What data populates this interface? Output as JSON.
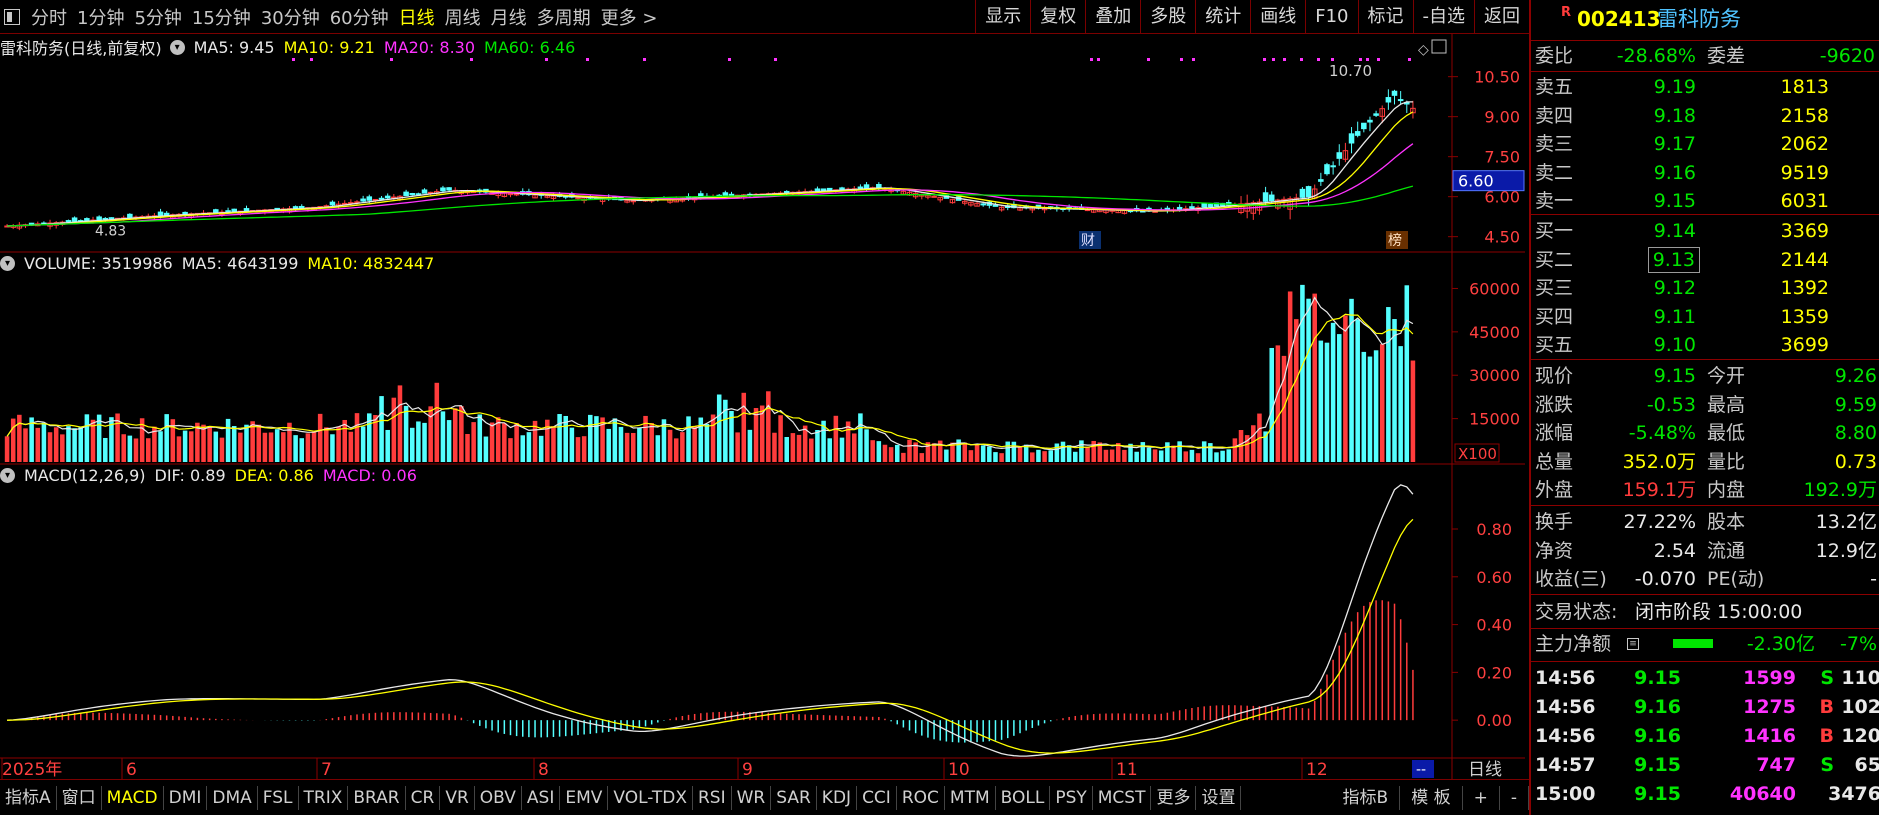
{
  "toolbar": {
    "periods": [
      "分时",
      "1分钟",
      "5分钟",
      "15分钟",
      "30分钟",
      "60分钟",
      "日线",
      "周线",
      "月线",
      "多周期",
      "更多 >"
    ],
    "active_period": "日线",
    "buttons": [
      "显示",
      "复权",
      "叠加",
      "多股",
      "统计",
      "画线",
      "F10",
      "标记",
      "-自选",
      "返回"
    ]
  },
  "header": {
    "price": {
      "name": "雷科防务(日线,前复权)",
      "ma5": "MA5: 9.45",
      "ma10": "MA10: 9.21",
      "ma20": "MA20: 8.30",
      "ma60": "MA60: 6.46"
    },
    "volume": {
      "name": "VOLUME: 3519986",
      "ma5": "MA5: 4643199",
      "ma10": "MA10: 4832447"
    },
    "macd": {
      "name": "MACD(12,26,9)",
      "dif": "DIF: 0.89",
      "dea": "DEA: 0.86",
      "macd": "MACD: 0.06"
    }
  },
  "chart_data": [
    {
      "type": "candlestick",
      "panel": "price",
      "y_ticks": [
        "10.50",
        "9.00",
        "7.50",
        "6.00",
        "4.50"
      ],
      "ylim": [
        4.0,
        11.2
      ],
      "current_price_tag": "6.60",
      "annotations": {
        "high": "10.70",
        "low": "4.83",
        "badge_cai": "财",
        "badge_bang": "榜"
      },
      "series": [
        {
          "name": "MA5",
          "color": "#e8e8e8"
        },
        {
          "name": "MA10",
          "color": "#ffff00"
        },
        {
          "name": "MA20",
          "color": "#ff33ff"
        },
        {
          "name": "MA60",
          "color": "#00e600"
        }
      ]
    },
    {
      "type": "bar",
      "panel": "volume",
      "y_ticks": [
        "60000",
        "45000",
        "30000",
        "15000"
      ],
      "unit": "X100",
      "ylim": [
        0,
        65000
      ],
      "series": [
        {
          "name": "MA5",
          "color": "#e8e8e8"
        },
        {
          "name": "MA10",
          "color": "#ffff00"
        }
      ]
    },
    {
      "type": "bar",
      "panel": "macd",
      "y_ticks": [
        "0.80",
        "0.60",
        "0.40",
        "0.20",
        "0.00"
      ],
      "ylim": [
        -0.15,
        0.98
      ],
      "series": [
        {
          "name": "DIF",
          "color": "#e8e8e8"
        },
        {
          "name": "DEA",
          "color": "#ffff00"
        },
        {
          "name": "MACD",
          "color": "#ff33ff"
        }
      ]
    }
  ],
  "x_axis": {
    "labels": [
      "2025年",
      "6",
      "7",
      "8",
      "9",
      "10",
      "11",
      "12"
    ],
    "right_tag": "--",
    "period_label": "日线"
  },
  "bottom": {
    "tabs": [
      "指标A",
      "窗口",
      "MACD",
      "DMI",
      "DMA",
      "FSL",
      "TRIX",
      "BRAR",
      "CR",
      "VR",
      "OBV",
      "ASI",
      "EMV",
      "VOL-TDX",
      "RSI",
      "WR",
      "SAR",
      "KDJ",
      "CCI",
      "ROC",
      "MTM",
      "BOLL",
      "PSY",
      "MCST",
      "更多",
      "设置"
    ],
    "active": "MACD",
    "right": [
      "指标B",
      "模 板",
      "+",
      "-"
    ]
  },
  "panel": {
    "badge": "R",
    "code": "002413",
    "name": "雷科防务",
    "weibi": {
      "label": "委比",
      "value": "-28.68%",
      "diff_label": "委差",
      "diff": "-9620"
    },
    "asks": [
      {
        "label": "卖五",
        "price": "9.19",
        "vol": "1813"
      },
      {
        "label": "卖四",
        "price": "9.18",
        "vol": "2158"
      },
      {
        "label": "卖三",
        "price": "9.17",
        "vol": "2062"
      },
      {
        "label": "卖二",
        "price": "9.16",
        "vol": "9519"
      },
      {
        "label": "卖一",
        "price": "9.15",
        "vol": "6031"
      }
    ],
    "bids": [
      {
        "label": "买一",
        "price": "9.14",
        "vol": "3369"
      },
      {
        "label": "买二",
        "price": "9.13",
        "vol": "2144"
      },
      {
        "label": "买三",
        "price": "9.12",
        "vol": "1392"
      },
      {
        "label": "买四",
        "price": "9.11",
        "vol": "1359"
      },
      {
        "label": "买五",
        "price": "9.10",
        "vol": "3699"
      }
    ],
    "quote": [
      {
        "l1": "现价",
        "v1": "9.15",
        "c1": "green",
        "l2": "今开",
        "v2": "9.26",
        "c2": "green"
      },
      {
        "l1": "涨跌",
        "v1": "-0.53",
        "c1": "green",
        "l2": "最高",
        "v2": "9.59",
        "c2": "green"
      },
      {
        "l1": "涨幅",
        "v1": "-5.48%",
        "c1": "green",
        "l2": "最低",
        "v2": "8.80",
        "c2": "green"
      },
      {
        "l1": "总量",
        "v1": "352.0万",
        "c1": "yellow",
        "l2": "量比",
        "v2": "0.73",
        "c2": "yellow"
      },
      {
        "l1": "外盘",
        "v1": "159.1万",
        "c1": "red",
        "l2": "内盘",
        "v2": "192.9万",
        "c2": "green"
      }
    ],
    "stats": [
      {
        "l1": "换手",
        "v1": "27.22%",
        "l2": "股本",
        "v2": "13.2亿"
      },
      {
        "l1": "净资",
        "v1": "2.54",
        "l2": "流通",
        "v2": "12.9亿"
      },
      {
        "l1": "收益(三)",
        "v1": "-0.070",
        "l2": "PE(动)",
        "v2": "-"
      }
    ],
    "status": {
      "label": "交易状态:",
      "value": "闭市阶段 15:00:00"
    },
    "flow": {
      "label": "主力净额",
      "value": "-2.30亿",
      "pct": "-7%"
    },
    "ticks": [
      {
        "time": "14:56",
        "price": "9.15",
        "vol": "1599",
        "side": "S",
        "n": "110"
      },
      {
        "time": "14:56",
        "price": "9.16",
        "vol": "1275",
        "side": "B",
        "n": "102"
      },
      {
        "time": "14:56",
        "price": "9.16",
        "vol": "1416",
        "side": "B",
        "n": "120"
      },
      {
        "time": "14:57",
        "price": "9.15",
        "vol": "747",
        "side": "S",
        "n": "65"
      },
      {
        "time": "15:00",
        "price": "9.15",
        "vol": "40640",
        "side": "",
        "n": "3476"
      }
    ]
  }
}
